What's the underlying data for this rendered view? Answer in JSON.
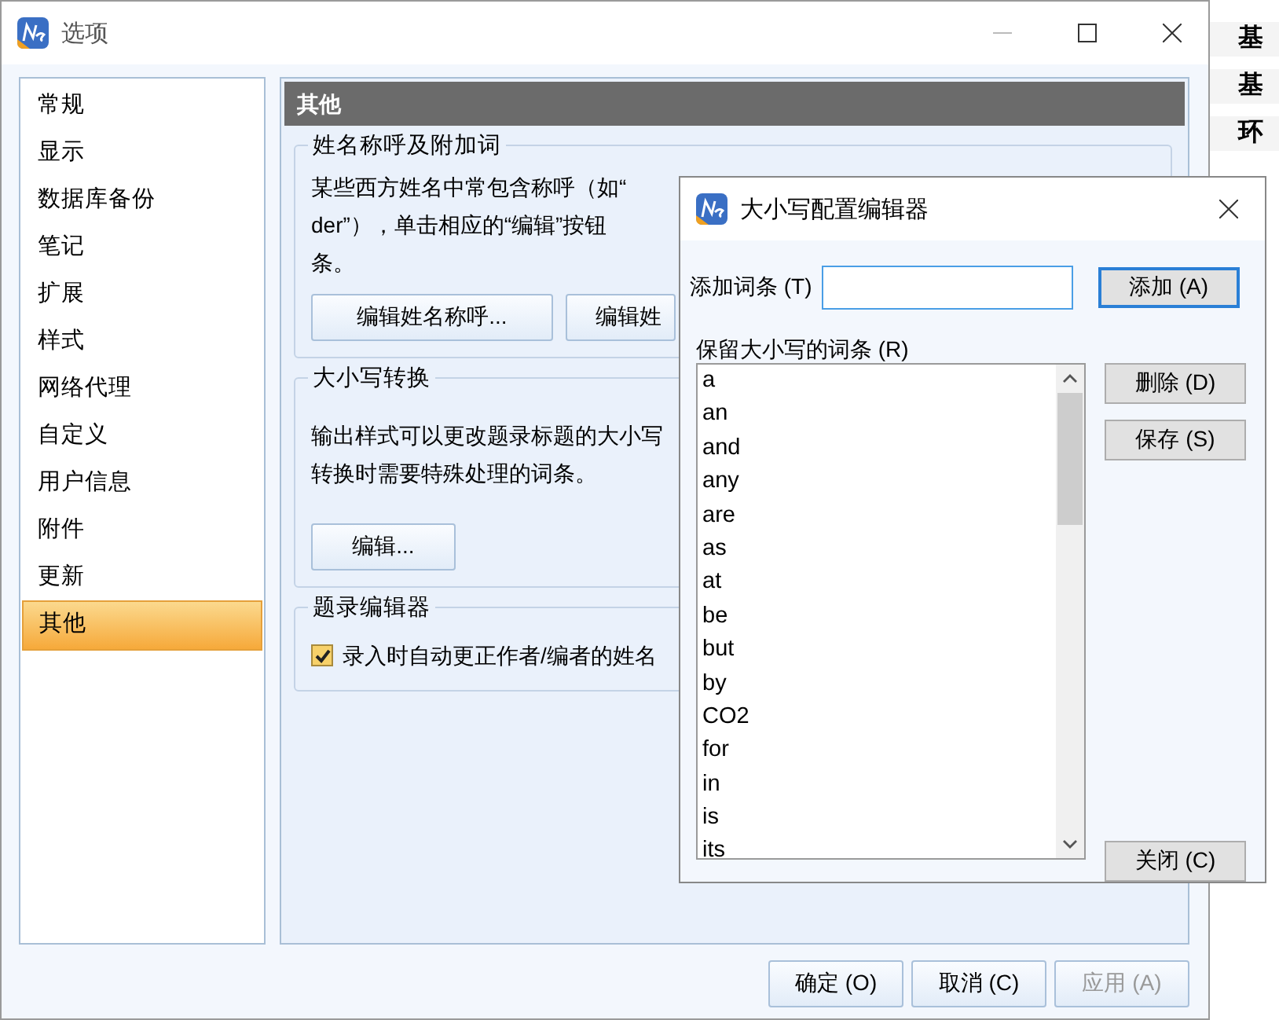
{
  "background": {
    "rows": [
      "基",
      "基",
      "环"
    ]
  },
  "window": {
    "title": "选项"
  },
  "sidebar": {
    "items": [
      {
        "label": "常规",
        "selected": false
      },
      {
        "label": "显示",
        "selected": false
      },
      {
        "label": "数据库备份",
        "selected": false
      },
      {
        "label": "笔记",
        "selected": false
      },
      {
        "label": "扩展",
        "selected": false
      },
      {
        "label": "样式",
        "selected": false
      },
      {
        "label": "网络代理",
        "selected": false
      },
      {
        "label": "自定义",
        "selected": false
      },
      {
        "label": "用户信息",
        "selected": false
      },
      {
        "label": "附件",
        "selected": false
      },
      {
        "label": "更新",
        "selected": false
      },
      {
        "label": "其他",
        "selected": true
      }
    ]
  },
  "panel": {
    "header": "其他",
    "groups": [
      {
        "kind": "buttons",
        "title": "姓名称呼及附加词",
        "lines": [
          "某些西方姓名中常包含称呼（如“",
          "der”），单击相应的“编辑”按钮",
          "条。"
        ],
        "buttons": [
          "编辑姓名称呼...",
          "编辑姓"
        ]
      },
      {
        "kind": "buttons",
        "title": "大小写转换",
        "lines": [
          "输出样式可以更改题录标题的大小写",
          "转换时需要特殊处理的词条。"
        ],
        "buttons": [
          "编辑..."
        ]
      },
      {
        "kind": "checkbox",
        "title": "题录编辑器",
        "label": "录入时自动更正作者/编者的姓名",
        "checked": true
      }
    ]
  },
  "footer": {
    "buttons": [
      {
        "label": "确定 (O)",
        "disabled": false
      },
      {
        "label": "取消 (C)",
        "disabled": false
      },
      {
        "label": "应用 (A)",
        "disabled": true
      }
    ]
  },
  "dialog": {
    "title": "大小写配置编辑器",
    "add_label": "添加词条 (T)",
    "add_button": "添加 (A)",
    "list_label": "保留大小写的词条 (R)",
    "words": [
      "a",
      "an",
      "and",
      "any",
      "are",
      "as",
      "at",
      "be",
      "but",
      "by",
      "CO2",
      "for",
      "in",
      "is",
      "its"
    ],
    "buttons": [
      "删除 (D)",
      "保存 (S)"
    ],
    "close_button": "关闭 (C)"
  }
}
